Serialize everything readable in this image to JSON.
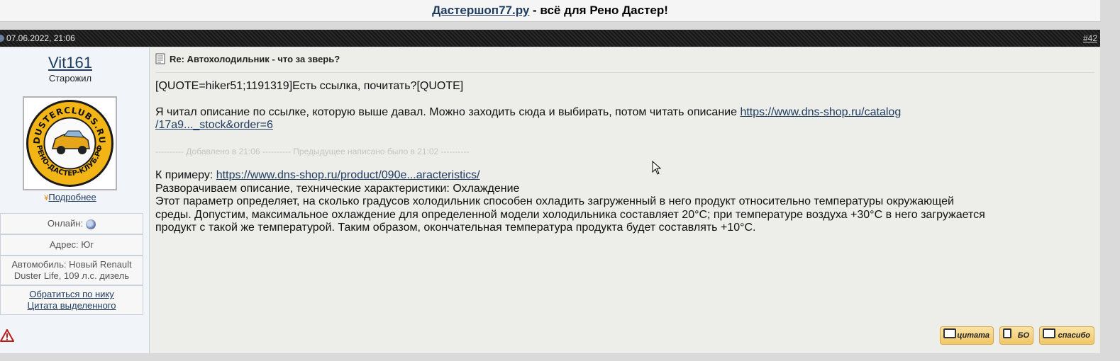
{
  "banner": {
    "link_text": "Дастершоп77.ру",
    "suffix": " - всё для Рено Дастер!"
  },
  "post_header": {
    "date": "07.06.2022, 21:06",
    "post_number": "#42"
  },
  "user": {
    "name": "Vit161",
    "title": "Старожил",
    "avatar_text_top": "DUSTERCLUBS.RU",
    "avatar_text_bottom": "РЕНО-ДАСТЕР-КЛУБ.РФ",
    "more_label": "Подробнее",
    "online_label": "Онлайн:",
    "address_label": "Адрес: Юг",
    "car_line1": "Автомобиль: Новый Renault",
    "car_line2": "Duster Life, 109 л.с. дизель",
    "action_nick": "Обратиться по нику",
    "action_quote": "Цитата выделенного"
  },
  "post": {
    "title": "Re: Автохолодильник - что за зверь?",
    "quote_line": "[QUOTE=hiker51;1191319]Есть ссылка, почитать?[QUOTE]",
    "para1_text": "Я читал описание по ссылке, которую выше давал. Можно заходить сюда и выбирать, потом читать описание ",
    "para1_link_a": "https://www.dns-shop.ru/catalog",
    "para1_link_b": "/17a9..._stock&order=6",
    "added_note": "---------- Добавлено в 21:06 ---------- Предыдущее написано было в 21:02 ----------",
    "example_label": "К примеру: ",
    "example_link": "https://www.dns-shop.ru/product/090e...aracteristics/",
    "line_expand": "Разворачиваем описание, технические характеристики: Охлаждение",
    "line_body1": "Этот параметр определяет, на сколько градусов холодильник способен охладить загруженный в него продукт относительно температуры окружающей",
    "line_body2": "среды. Допустим, максимальное охлаждение для определенной модели холодильника составляет 20°C; при температуре воздуха +30°C в него загружается",
    "line_body3": "продукт с такой же температурой. Таким образом, окончательная температура продукта будет составлять +10°C."
  },
  "buttons": {
    "quote": "цитата",
    "bo": "БО",
    "thanks": "спасибо"
  },
  "colors": {
    "link": "#1e3a5c",
    "header_bar": "#1f1f1f",
    "post_bg": "#ededea",
    "sidebar_bg": "#f1f4f8",
    "button_gold": "#f1c768"
  }
}
